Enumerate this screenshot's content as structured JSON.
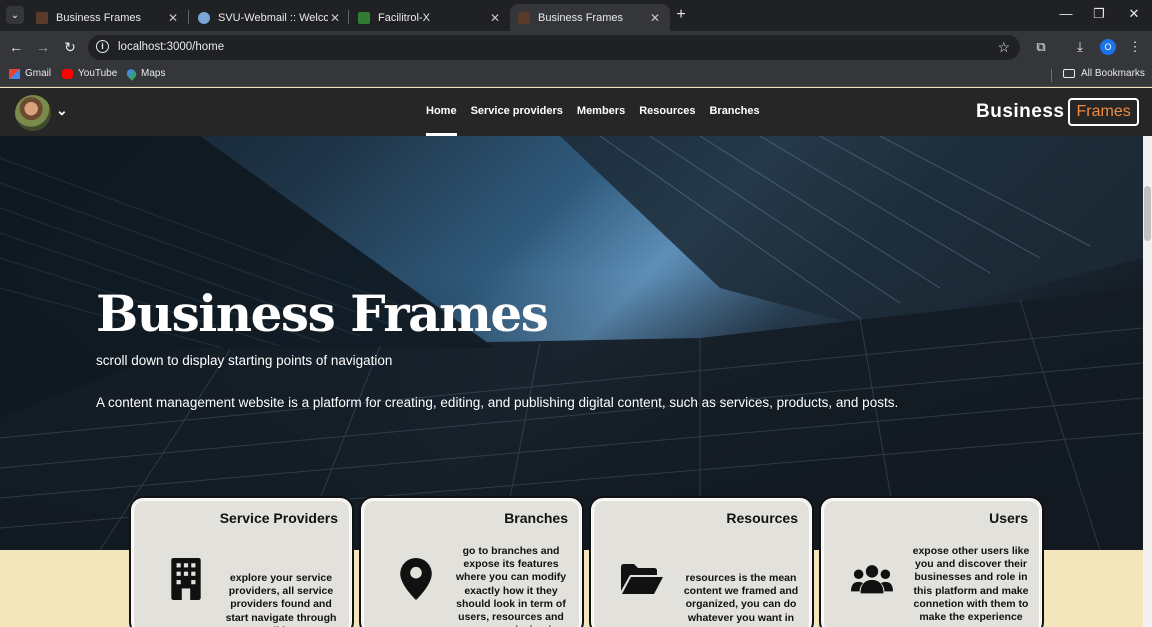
{
  "browser": {
    "tabs": [
      {
        "title": "Business Frames",
        "favicon_color": "#5a3a2a"
      },
      {
        "title": "SVU-Webmail :: Welcome",
        "favicon_color": "#7aa7d8"
      },
      {
        "title": "Facilitrol-X",
        "favicon_color": "#2e7d32"
      },
      {
        "title": "Business Frames",
        "favicon_color": "#5a3a2a"
      }
    ],
    "active_tab_index": 3,
    "url": "localhost:3000/home",
    "profile_initial": "O",
    "bookmarks": [
      {
        "label": "Gmail",
        "icon": "gmail-icon",
        "color": "#ea4335"
      },
      {
        "label": "YouTube",
        "icon": "youtube-icon",
        "color": "#ff0000"
      },
      {
        "label": "Maps",
        "icon": "maps-icon",
        "color": "#34a853"
      }
    ],
    "all_bookmarks_label": "All Bookmarks"
  },
  "site": {
    "nav": {
      "links": [
        "Home",
        "Service providers",
        "Members",
        "Resources",
        "Branches"
      ],
      "active_index": 0
    },
    "brand": {
      "main": "Business",
      "boxed": "Frames",
      "accent": "#f08a3c"
    },
    "hero": {
      "title": "Business Frames",
      "subtitle": "scroll down to display starting points of navigation",
      "description": "A content management website is a platform for creating, editing, and publishing digital content, such as services, products, and posts."
    },
    "cards": [
      {
        "title": "Service Providers",
        "icon": "building-icon",
        "text": "explore your service providers, all service providers found and start navigate through all its"
      },
      {
        "title": "Branches",
        "icon": "location-pin-icon",
        "text": "go to branches and expose its features where you can modify exactly how it they should look in term of users, resources and user permission in"
      },
      {
        "title": "Resources",
        "icon": "folder-open-icon",
        "text": "resources is the mean content we framed and organized, you can do whatever you want in"
      },
      {
        "title": "Users",
        "icon": "users-icon",
        "text": "expose other users like you and discover their businesses and role in this platform and make connetion with them to make the experience"
      }
    ]
  }
}
